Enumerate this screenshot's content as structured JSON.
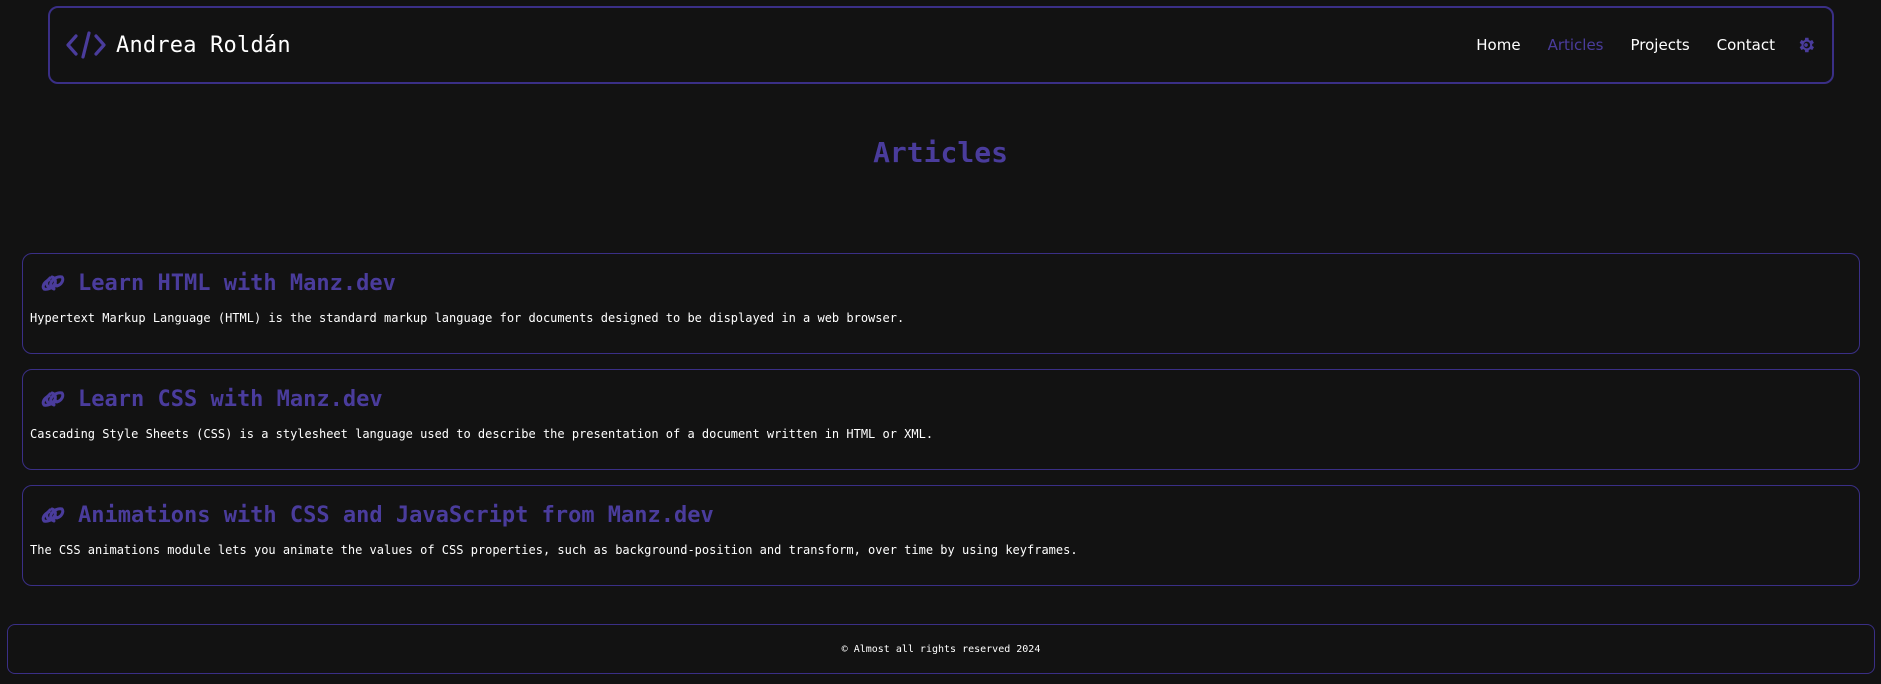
{
  "header": {
    "brand_name": "Andrea Roldán",
    "brand_icon": "code-icon",
    "nav": [
      {
        "label": "Home",
        "active": false
      },
      {
        "label": "Articles",
        "active": true
      },
      {
        "label": "Projects",
        "active": false
      },
      {
        "label": "Contact",
        "active": false
      }
    ],
    "theme_icon": "gear-icon"
  },
  "main": {
    "title": "Articles",
    "articles": [
      {
        "icon": "link-icon",
        "title": "Learn HTML with Manz.dev",
        "description": "Hypertext Markup Language (HTML) is the standard markup language for documents designed to be displayed in a web browser."
      },
      {
        "icon": "link-icon",
        "title": "Learn CSS with Manz.dev",
        "description": "Cascading Style Sheets (CSS) is a stylesheet language used to describe the presentation of a document written in HTML or XML."
      },
      {
        "icon": "link-icon",
        "title": "Animations with CSS and JavaScript from Manz.dev",
        "description": "The CSS animations module lets you animate the values of CSS properties, such as background-position and transform, over time by using keyframes."
      }
    ]
  },
  "footer": {
    "text": "© Almost all rights reserved 2024"
  },
  "colors": {
    "background": "#121212",
    "accent": "#4a3c9c",
    "border": "#3a2f86",
    "text": "#ffffff"
  }
}
